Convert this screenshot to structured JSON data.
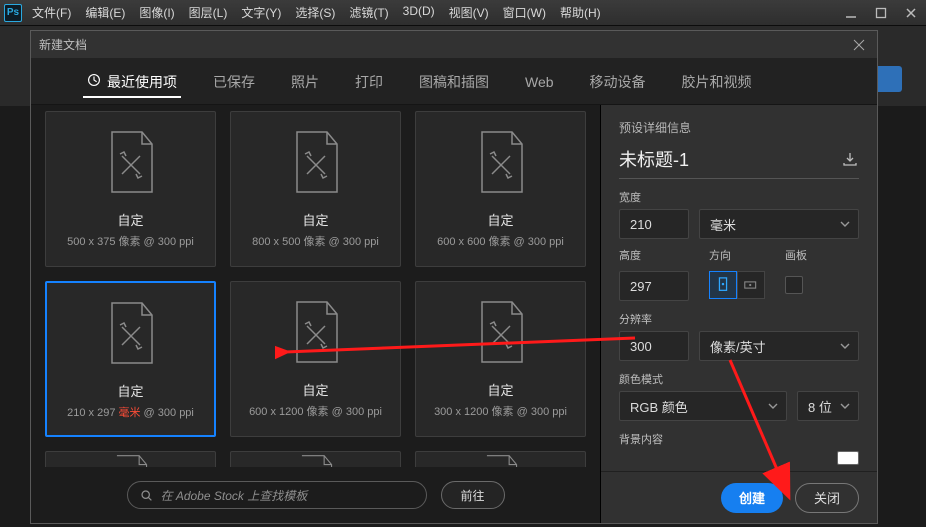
{
  "app": {
    "logo_text": "Ps"
  },
  "menu": [
    "文件(F)",
    "编辑(E)",
    "图像(I)",
    "图层(L)",
    "文字(Y)",
    "选择(S)",
    "滤镜(T)",
    "3D(D)",
    "视图(V)",
    "窗口(W)",
    "帮助(H)"
  ],
  "dialog": {
    "title": "新建文档"
  },
  "tabs": [
    "最近使用项",
    "已保存",
    "照片",
    "打印",
    "图稿和插图",
    "Web",
    "移动设备",
    "胶片和视频"
  ],
  "presets": [
    {
      "title": "自定",
      "dims_pre": "500 x 375 像素 @ 300 ppi",
      "dims_hl": ""
    },
    {
      "title": "自定",
      "dims_pre": "800 x 500 像素 @ 300 ppi",
      "dims_hl": ""
    },
    {
      "title": "自定",
      "dims_pre": "600 x 600 像素 @ 300 ppi",
      "dims_hl": ""
    },
    {
      "title": "自定",
      "dims_pre": "210 x 297 ",
      "dims_hl": "毫米",
      "dims_post": " @ 300 ppi",
      "selected": true
    },
    {
      "title": "自定",
      "dims_pre": "600 x 1200 像素 @ 300 ppi",
      "dims_hl": ""
    },
    {
      "title": "自定",
      "dims_pre": "300 x 1200 像素 @ 300 ppi",
      "dims_hl": ""
    }
  ],
  "search": {
    "placeholder": "在 Adobe Stock 上查找模板",
    "go_label": "前往"
  },
  "right": {
    "section": "预设详细信息",
    "doc_name": "未标题-1",
    "width_label": "宽度",
    "width_value": "210",
    "width_unit": "毫米",
    "height_label": "高度",
    "height_value": "297",
    "orient_label": "方向",
    "artboard_label": "画板",
    "res_label": "分辨率",
    "res_value": "300",
    "res_unit": "像素/英寸",
    "mode_label": "颜色模式",
    "mode_value": "RGB 颜色",
    "depth_value": "8 位",
    "bg_label": "背景内容",
    "create_label": "创建",
    "close_label": "关闭"
  }
}
